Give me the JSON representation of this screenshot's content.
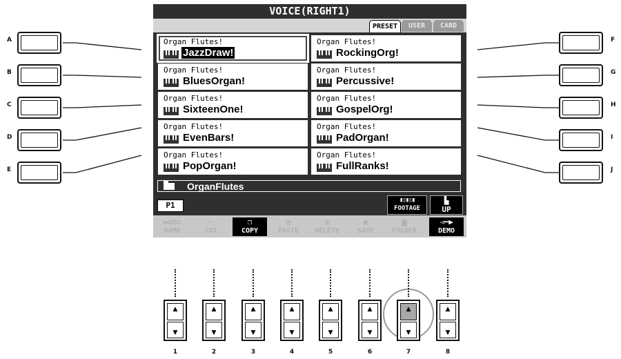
{
  "screen": {
    "title": "VOICE(RIGHT1)",
    "tabs": [
      "PRESET",
      "USER",
      "CARD"
    ],
    "active_tab": "PRESET",
    "voices": [
      {
        "category": "Organ Flutes!",
        "name": "JazzDraw!",
        "selected": true
      },
      {
        "category": "Organ Flutes!",
        "name": "BluesOrgan!"
      },
      {
        "category": "Organ Flutes!",
        "name": "SixteenOne!"
      },
      {
        "category": "Organ Flutes!",
        "name": "EvenBars!"
      },
      {
        "category": "Organ Flutes!",
        "name": "PopOrgan!"
      },
      {
        "category": "Organ Flutes!",
        "name": "RockingOrg!"
      },
      {
        "category": "Organ Flutes!",
        "name": "Percussive!"
      },
      {
        "category": "Organ Flutes!",
        "name": "GospelOrg!"
      },
      {
        "category": "Organ Flutes!",
        "name": "PadOrgan!"
      },
      {
        "category": "Organ Flutes!",
        "name": "FullRanks!"
      }
    ],
    "folder": "OrganFlutes",
    "page": "P1",
    "footage_label": "FOOTAGE",
    "up_label": "UP",
    "function_buttons": [
      {
        "label": "NAME",
        "icon": "abc-icon",
        "enabled": false
      },
      {
        "label": "CUT",
        "icon": "scissors-icon",
        "enabled": false
      },
      {
        "label": "COPY",
        "icon": "copy-icon",
        "enabled": true
      },
      {
        "label": "PASTE",
        "icon": "paste-icon",
        "enabled": false
      },
      {
        "label": "DELETE",
        "icon": "trash-icon",
        "enabled": false
      },
      {
        "label": "SAVE",
        "icon": "floppy-icon",
        "enabled": false
      },
      {
        "label": "FOLDER",
        "icon": "folder-icon",
        "enabled": false
      },
      {
        "label": "DEMO",
        "icon": "trumpet-icon",
        "enabled": true
      }
    ]
  },
  "side_buttons": {
    "left": [
      "A",
      "B",
      "C",
      "D",
      "E"
    ],
    "right": [
      "F",
      "G",
      "H",
      "I",
      "J"
    ]
  },
  "soft_buttons": [
    "1",
    "2",
    "3",
    "4",
    "5",
    "6",
    "7",
    "8"
  ],
  "highlighted_soft_button": "7"
}
